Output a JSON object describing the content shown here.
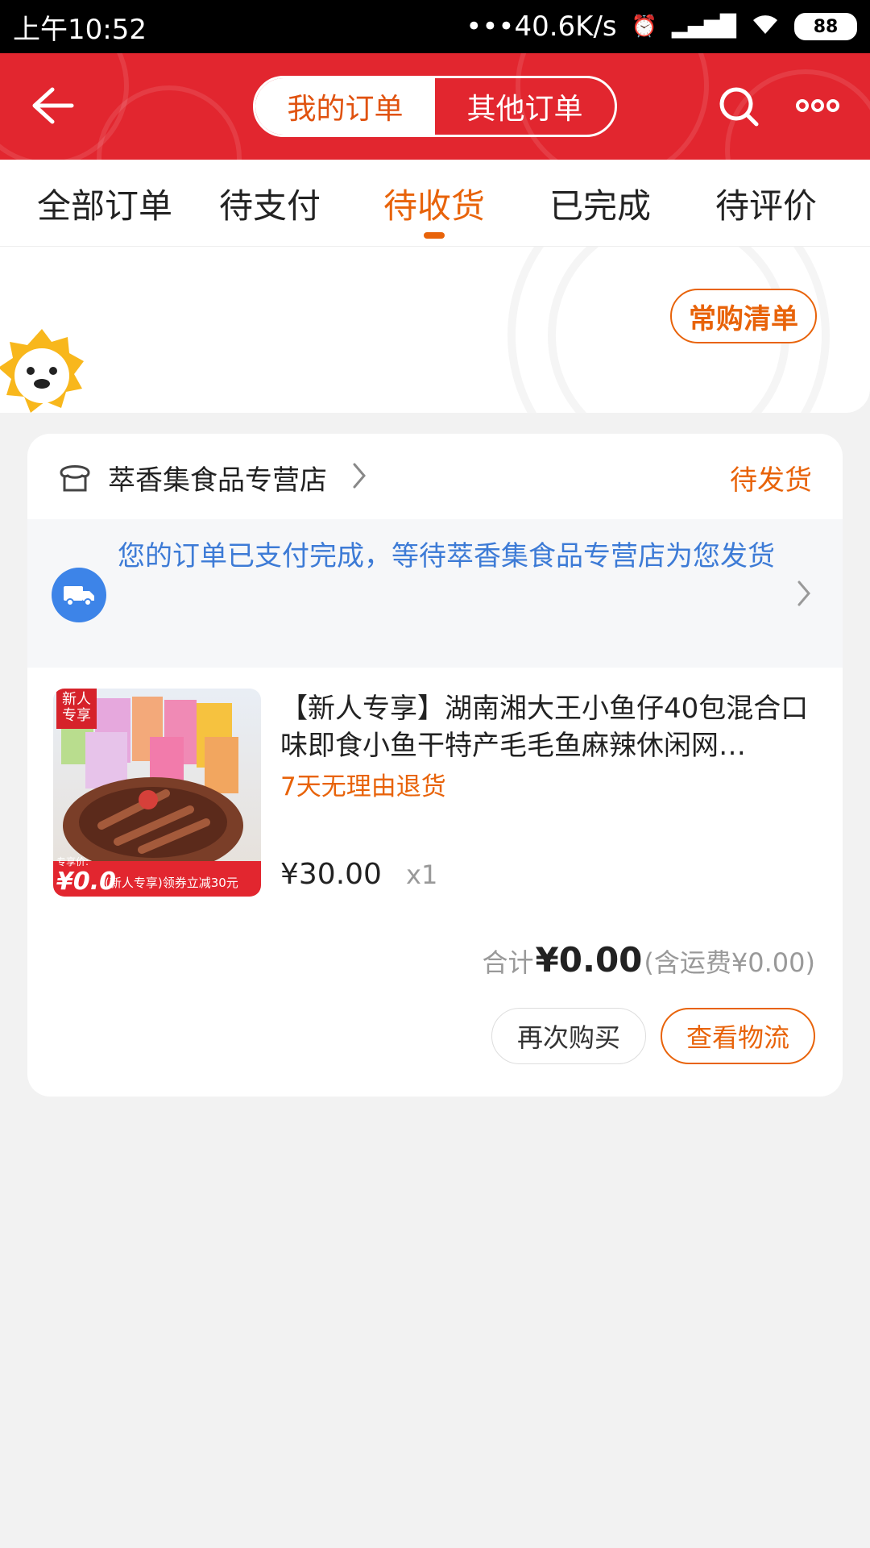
{
  "status_bar": {
    "time": "上午10:52",
    "speed": "•••40.6K/s",
    "battery": "88"
  },
  "header": {
    "tab_my_orders": "我的订单",
    "tab_other_orders": "其他订单",
    "brand_color": "#e2262f"
  },
  "tabs": {
    "items": [
      "全部订单",
      "待支付",
      "待收货",
      "已完成",
      "待评价"
    ],
    "active_index": 2,
    "accent_color": "#e8630a"
  },
  "banner": {
    "fav_list_label": "常购清单"
  },
  "order": {
    "shop_name": "萃香集食品专营店",
    "status": "待发货",
    "notice": "您的订单已支付完成，等待萃香集食品专营店为您发货",
    "product_title": "【新人专享】湖南湘大王小鱼仔40包混合口味即食小鱼干特产毛毛鱼麻辣休闲网…",
    "return_policy": "7天无理由退货",
    "price": "¥30.00",
    "quantity": "x1",
    "total_prefix": "合计",
    "total_amount": "¥0.00",
    "shipping": "(含运费¥0.00)",
    "buy_again_label": "再次购买",
    "view_logistics_label": "查看物流",
    "product_image": {
      "badge_top": "新人\n专享",
      "badge_price_label": "专享价:",
      "badge_price": "¥0.0",
      "badge_promo": "(新人专享)领券立减30元"
    }
  }
}
